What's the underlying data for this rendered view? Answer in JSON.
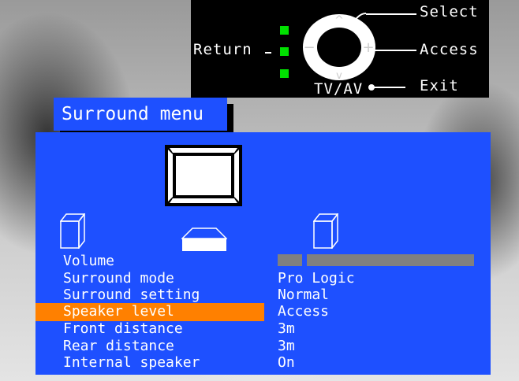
{
  "remote_help": {
    "select_label": "Select",
    "return_label": "Return",
    "access_label": "Access",
    "tvav_label": "TV/AV",
    "exit_label": "Exit",
    "highlight_color": "#00e000"
  },
  "menu": {
    "title": "Surround menu",
    "panel_color": "#1e50ff",
    "highlight_color": "#ff8000",
    "items": [
      {
        "label": "Volume",
        "value": ""
      },
      {
        "label": "Surround mode",
        "value": "Pro Logic"
      },
      {
        "label": "Surround setting",
        "value": "Normal"
      },
      {
        "label": "Speaker level",
        "value": "Access",
        "selected": true
      },
      {
        "label": "Front distance",
        "value": "3m"
      },
      {
        "label": "Rear distance",
        "value": "3m"
      },
      {
        "label": "Internal speaker",
        "value": "On"
      }
    ]
  },
  "icons": {
    "tv": "television-icon",
    "left_speaker": "rear-left-speaker-icon",
    "right_speaker": "rear-right-speaker-icon",
    "center_speaker": "center-speaker-icon",
    "remote_pad": "remote-navigation-pad-icon"
  }
}
